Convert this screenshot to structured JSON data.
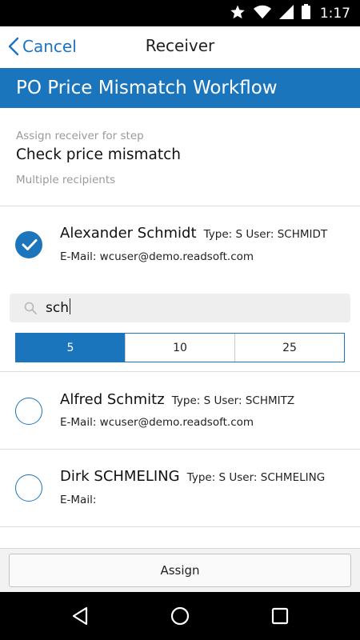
{
  "status_bar": {
    "time": "1:17",
    "icons": [
      "star-icon",
      "wifi-icon",
      "cell-signal-icon",
      "battery-icon"
    ]
  },
  "nav": {
    "cancel_label": "Cancel",
    "title": "Receiver"
  },
  "workflow": {
    "title": "PO Price Mismatch Workflow"
  },
  "step": {
    "hint": "Assign receiver for step",
    "name": "Check price mismatch",
    "multiple": "Multiple recipients"
  },
  "selected_user": {
    "name": "Alexander Schmidt",
    "meta": "Type: S User: SCHMIDT",
    "email": "E-Mail: wcuser@demo.readsoft.com",
    "checked": true
  },
  "search": {
    "value": "sch",
    "icon": "search-icon"
  },
  "page_size": {
    "options": [
      "5",
      "10",
      "25"
    ],
    "selected": "5"
  },
  "results": [
    {
      "name": "Alfred Schmitz",
      "meta": "Type: S User: SCHMITZ",
      "email": "E-Mail: wcuser@demo.readsoft.com",
      "checked": false
    },
    {
      "name": "Dirk SCHMELING",
      "meta": "Type: S User: SCHMELING",
      "email": "E-Mail:",
      "checked": false
    }
  ],
  "footer": {
    "assign_label": "Assign"
  },
  "colors": {
    "accent": "#1b75bc",
    "link": "#1a73c4",
    "divider": "#dedede"
  }
}
